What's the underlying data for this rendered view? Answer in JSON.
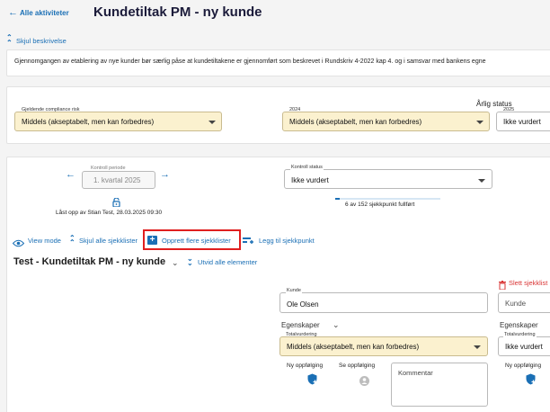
{
  "header": {
    "back_label": "Alle aktiviteter",
    "title": "Kundetiltak PM - ny kunde",
    "toggle_description": "Skjul beskrivelse",
    "description": "Gjennomgangen av etablering av nye kunder bør særlig påse at kundetiltakene er gjennomført som beskrevet i Rundskriv 4-2022 kap 4. og i samsvar med bankens egne"
  },
  "risk": {
    "compliance_label": "Gjeldende compliance risk",
    "compliance_value": "Middels (akseptabelt, men kan forbedres)",
    "year_label": "2024",
    "year_value": "Middels (akseptabelt, men kan forbedres)",
    "annual_status_title": "Årlig status",
    "annual_label": "2025",
    "annual_value": "Ikke vurdert"
  },
  "control": {
    "period_label": "Kontroll periode",
    "period_value": "1. kvartal 2025",
    "locked_text": "Låst opp av Stian Test, 28.03.2025 09:30",
    "status_label": "Kontroll status",
    "status_value": "Ikke vurdert",
    "progress_text": "6 av 152 sjekkpunkt fullført",
    "progress_fraction": 0.04
  },
  "toolbar": {
    "view_mode": "View mode",
    "hide_all": "Skjul alle sjekklister",
    "create_multiple": "Opprett flere sjekklister",
    "add_checkpoint": "Legg til sjekkpunkt"
  },
  "checklist": {
    "title": "Test - Kundetiltak PM - ny kunde",
    "expand_all": "Utvid alle elementer",
    "delete_label": "Slett sjekklist",
    "kunde_label": "Kunde",
    "kunde_value": "Ole Olsen",
    "kunde2_placeholder": "Kunde",
    "egenskaper": "Egenskaper",
    "egenskaper2": "Egenskaper",
    "total_label": "Totalvurdering",
    "total_value": "Middels (akseptabelt, men kan forbedres)",
    "total2_label": "Totalvurdering",
    "total2_value": "Ikke vurdert",
    "ny_oppfolging": "Ny oppfølging",
    "se_oppfolging": "Se oppfølging",
    "ny_oppfolging2": "Ny oppfølging",
    "kommentar_placeholder": "Kommentar"
  },
  "colors": {
    "accent": "#1a6fb5",
    "highlight_box": "#e01f1f",
    "selected_field": "#fbf1cf",
    "delete": "#d93434"
  }
}
